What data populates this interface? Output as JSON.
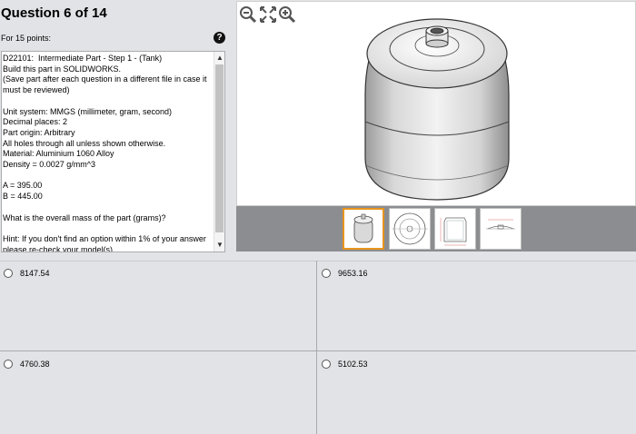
{
  "question": {
    "title": "Question 6 of 14",
    "points": "For 15 points:",
    "help": "?",
    "body": "D22101:  Intermediate Part - Step 1 - (Tank)\nBuild this part in SOLIDWORKS.\n(Save part after each question in a different file in case it must be reviewed)\n\nUnit system: MMGS (millimeter, gram, second)\nDecimal places: 2\nPart origin: Arbitrary\nAll holes through all unless shown otherwise.\nMaterial: Aluminium 1060 Alloy\nDensity = 0.0027 g/mm^3\n\nA = 395.00\nB = 445.00\n\nWhat is the overall mass of the part (grams)?\n\nHint: If you don't find an option within 1% of your answer please re-check your model(s)."
  },
  "scrollbar": {
    "up": "▲",
    "down": "▼"
  },
  "viewer": {
    "thumbnails": [
      "isometric",
      "top-view",
      "front-section",
      "side-view"
    ],
    "selected_thumbnail": 0
  },
  "answers": [
    {
      "id": "a",
      "label": "8147.54"
    },
    {
      "id": "b",
      "label": "9653.16"
    },
    {
      "id": "c",
      "label": "4760.38"
    },
    {
      "id": "d",
      "label": "5102.53"
    }
  ],
  "colors": {
    "accent": "#e7941d",
    "background": "#e1e3e6",
    "viewer_bar": "#8b8d90"
  }
}
